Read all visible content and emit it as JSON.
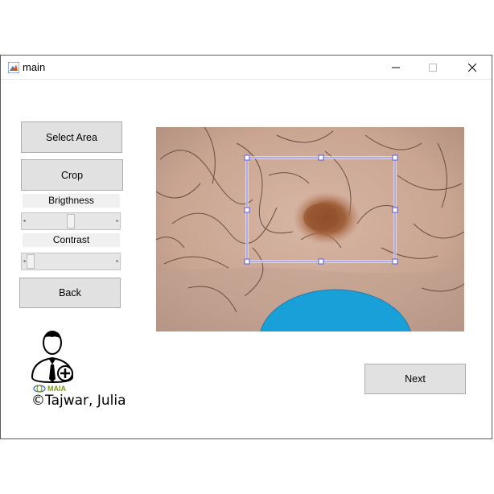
{
  "window": {
    "title": "main",
    "controls": {
      "minimize": "minimize-icon",
      "maximize": "maximize-icon",
      "close": "close-icon"
    }
  },
  "controls": {
    "select_area_label": "Select Area",
    "crop_label": "Crop",
    "brightness_label": "Brigthness",
    "contrast_label": "Contrast",
    "back_label": "Back",
    "next_label": "Next"
  },
  "sliders": {
    "brightness_level": 0.5,
    "contrast_level": 0.0
  },
  "logo": {
    "icon": "doctor-plus-icon",
    "maia_text": "MAIA",
    "credit_text": "©Tajwar, Julia"
  },
  "image": {
    "description_icon": "skin-lesion-image",
    "selection_color": "#5a5ae6",
    "probe_color": "#1aa0d8"
  }
}
